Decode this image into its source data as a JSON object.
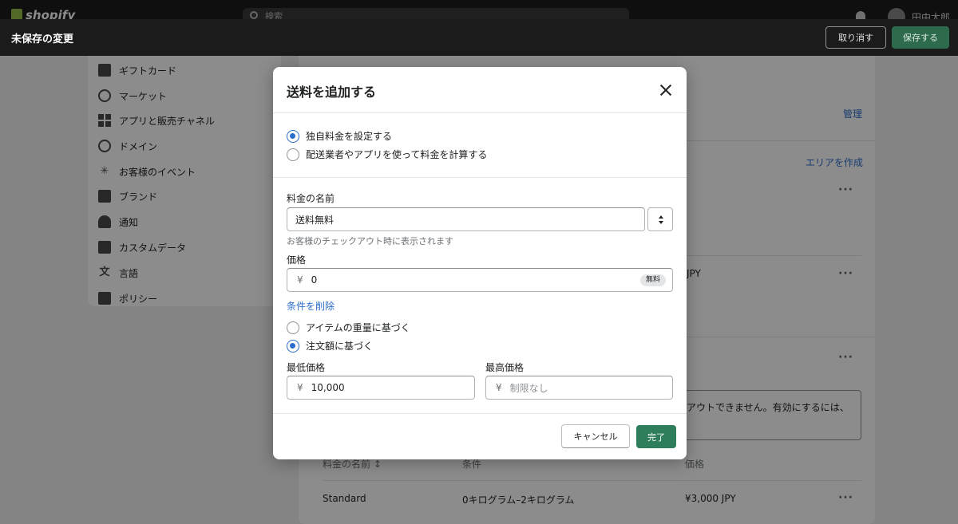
{
  "header": {
    "logo_text": "shopify",
    "search_placeholder": "検索",
    "username": "田中太郎"
  },
  "unsaved_bar": {
    "title": "未保存の変更",
    "discard_label": "取り消す",
    "save_label": "保存する"
  },
  "sidebar": {
    "items": [
      {
        "label": "ギフトカード",
        "icon": "gift-card-icon"
      },
      {
        "label": "マーケット",
        "icon": "globe-icon"
      },
      {
        "label": "アプリと販売チャネル",
        "icon": "apps-icon"
      },
      {
        "label": "ドメイン",
        "icon": "domain-icon"
      },
      {
        "label": "お客様のイベント",
        "icon": "customer-events-icon"
      },
      {
        "label": "ブランド",
        "icon": "brand-icon"
      },
      {
        "label": "通知",
        "icon": "bell-icon"
      },
      {
        "label": "カスタムデータ",
        "icon": "custom-data-icon"
      },
      {
        "label": "言語",
        "icon": "language-icon"
      },
      {
        "label": "ポリシー",
        "icon": "policy-icon"
      }
    ]
  },
  "background": {
    "manage_link": "管理",
    "create_zone_link": "エリアを作成",
    "price_fragment": "JPY",
    "warning_fragment": "アウトできません。有効にするには、",
    "table_headers": [
      "料金の名前 ↕",
      "条件",
      "価格"
    ],
    "table_row": {
      "name": "Standard",
      "condition": "0キログラム–2キログラム",
      "price": "¥3,000 JPY"
    }
  },
  "modal": {
    "title": "送料を追加する",
    "rate_type_options": [
      {
        "label": "独自料金を設定する",
        "checked": true
      },
      {
        "label": "配送業者やアプリを使って料金を計算する",
        "checked": false
      }
    ],
    "rate_name_label": "料金の名前",
    "rate_name_value": "送料無料",
    "rate_name_help": "お客様のチェックアウト時に表示されます",
    "price_label": "価格",
    "currency_symbol": "¥",
    "price_value": "0",
    "free_badge": "無料",
    "remove_conditions_link": "条件を削除",
    "condition_options": [
      {
        "label": "アイテムの重量に基づく",
        "checked": false
      },
      {
        "label": "注文額に基づく",
        "checked": true
      }
    ],
    "min_price_label": "最低価格",
    "min_price_value": "10,000",
    "max_price_label": "最高価格",
    "max_price_placeholder": "制限なし",
    "cancel_label": "キャンセル",
    "done_label": "完了"
  },
  "colors": {
    "accent_blue": "#2c6ecb",
    "primary_green": "#2e7d5b"
  }
}
